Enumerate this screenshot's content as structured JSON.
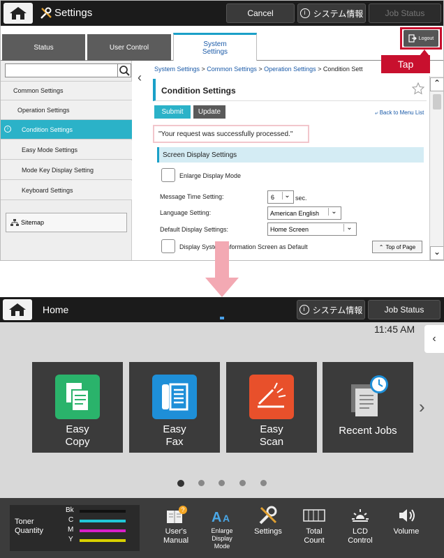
{
  "top": {
    "title": "Settings",
    "cancel_label": "Cancel",
    "sysinfo_label": "システム情報",
    "jobstatus_label": "Job Status",
    "tabs": [
      {
        "label": "Status"
      },
      {
        "label": "User Control"
      },
      {
        "label": "System\nSettings"
      }
    ],
    "logout_label": "Logout",
    "tap_label": "Tap",
    "sidebar": {
      "items": [
        {
          "label": "Common Settings"
        },
        {
          "label": "Operation Settings"
        },
        {
          "label": "Condition Settings"
        },
        {
          "label": "Easy Mode Settings"
        },
        {
          "label": "Mode Key Display Setting"
        },
        {
          "label": "Keyboard Settings"
        }
      ],
      "sitemap_label": "Sitemap"
    },
    "breadcrumb": [
      {
        "label": "System Settings"
      },
      {
        "label": "Common Settings"
      },
      {
        "label": "Operation Settings"
      },
      {
        "label": "Condition Sett"
      }
    ],
    "page_title": "Condition Settings",
    "submit_label": "Submit",
    "update_label": "Update",
    "back_label": "Back to Menu List",
    "success_msg": "\"Your request was successfully processed.\"",
    "section_title": "Screen Display Settings",
    "enlarge_label": "Enlarge Display Mode",
    "msg_time_label": "Message Time Setting:",
    "msg_time_value": "6",
    "sec_label": "sec.",
    "language_label": "Language Setting:",
    "language_value": "American English",
    "default_display_label": "Default Display Settings:",
    "default_display_value": "Home Screen",
    "display_sys_label": "Display System Information Screen as Default",
    "top_of_page_label": "Top of Page"
  },
  "bottom": {
    "title": "Home",
    "sysinfo_label": "システム情報",
    "jobstatus_label": "Job Status",
    "time": "11:45 AM",
    "tiles": [
      {
        "label": "Easy\nCopy",
        "color": "#2ab36b"
      },
      {
        "label": "Easy\nFax",
        "color": "#1e8fd8"
      },
      {
        "label": "Easy\nScan",
        "color": "#e8502b"
      },
      {
        "label": "Recent Jobs",
        "color": "#888888"
      }
    ],
    "toner": {
      "label": "Toner\nQuantity",
      "rows": [
        {
          "name": "Bk",
          "color": "#111111"
        },
        {
          "name": "C",
          "color": "#21c7d8"
        },
        {
          "name": "M",
          "color": "#d81fc8"
        },
        {
          "name": "Y",
          "color": "#d8d000"
        }
      ]
    },
    "footer": [
      {
        "label": "User's\nManual"
      },
      {
        "label": "Enlarge\nDisplay\nMode"
      },
      {
        "label": "Settings"
      },
      {
        "label": "Total\nCount"
      },
      {
        "label": "LCD\nControl"
      },
      {
        "label": "Volume"
      }
    ]
  }
}
